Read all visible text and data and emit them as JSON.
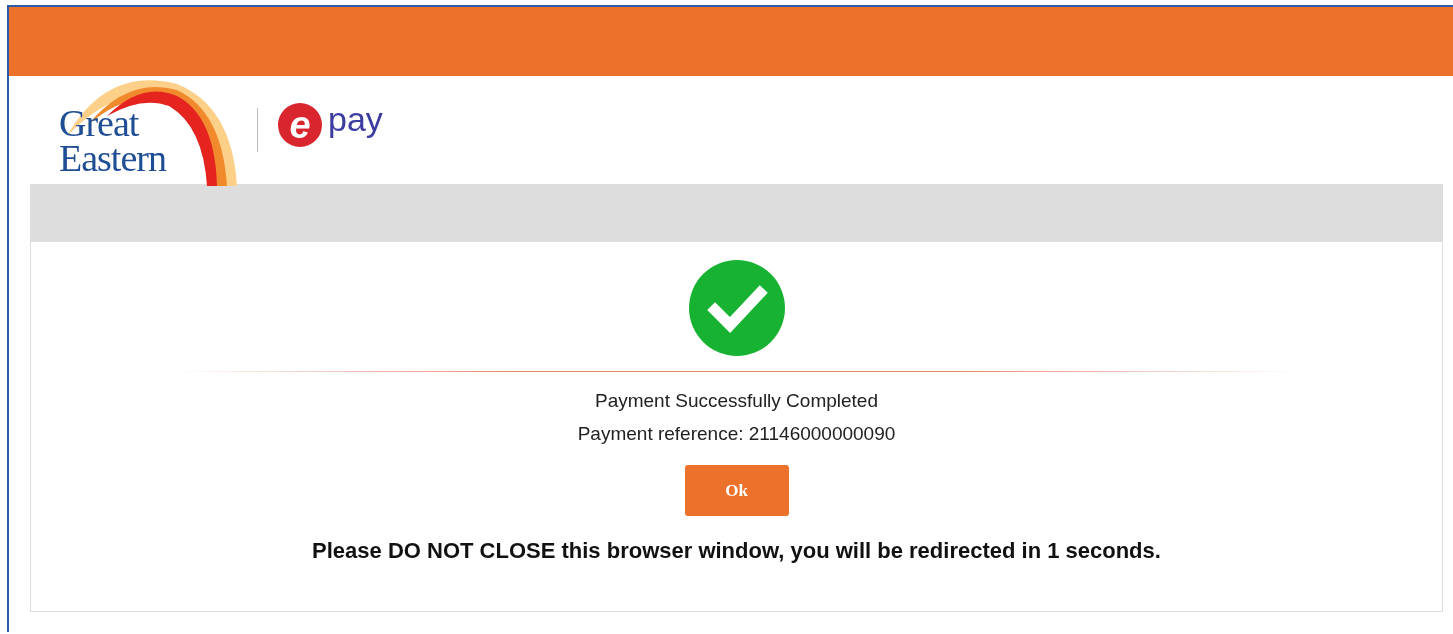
{
  "brand": {
    "name_lines": [
      "Great",
      "Eastern"
    ],
    "epay_mark": "e",
    "epay_word": "pay"
  },
  "result": {
    "success": true,
    "title": "Payment Successfully Completed",
    "reference": "Payment reference: 21146000000090"
  },
  "button": {
    "label": "Ok"
  },
  "notice": "Please DO NOT CLOSE this browser window, you will be redirected in 1 seconds."
}
